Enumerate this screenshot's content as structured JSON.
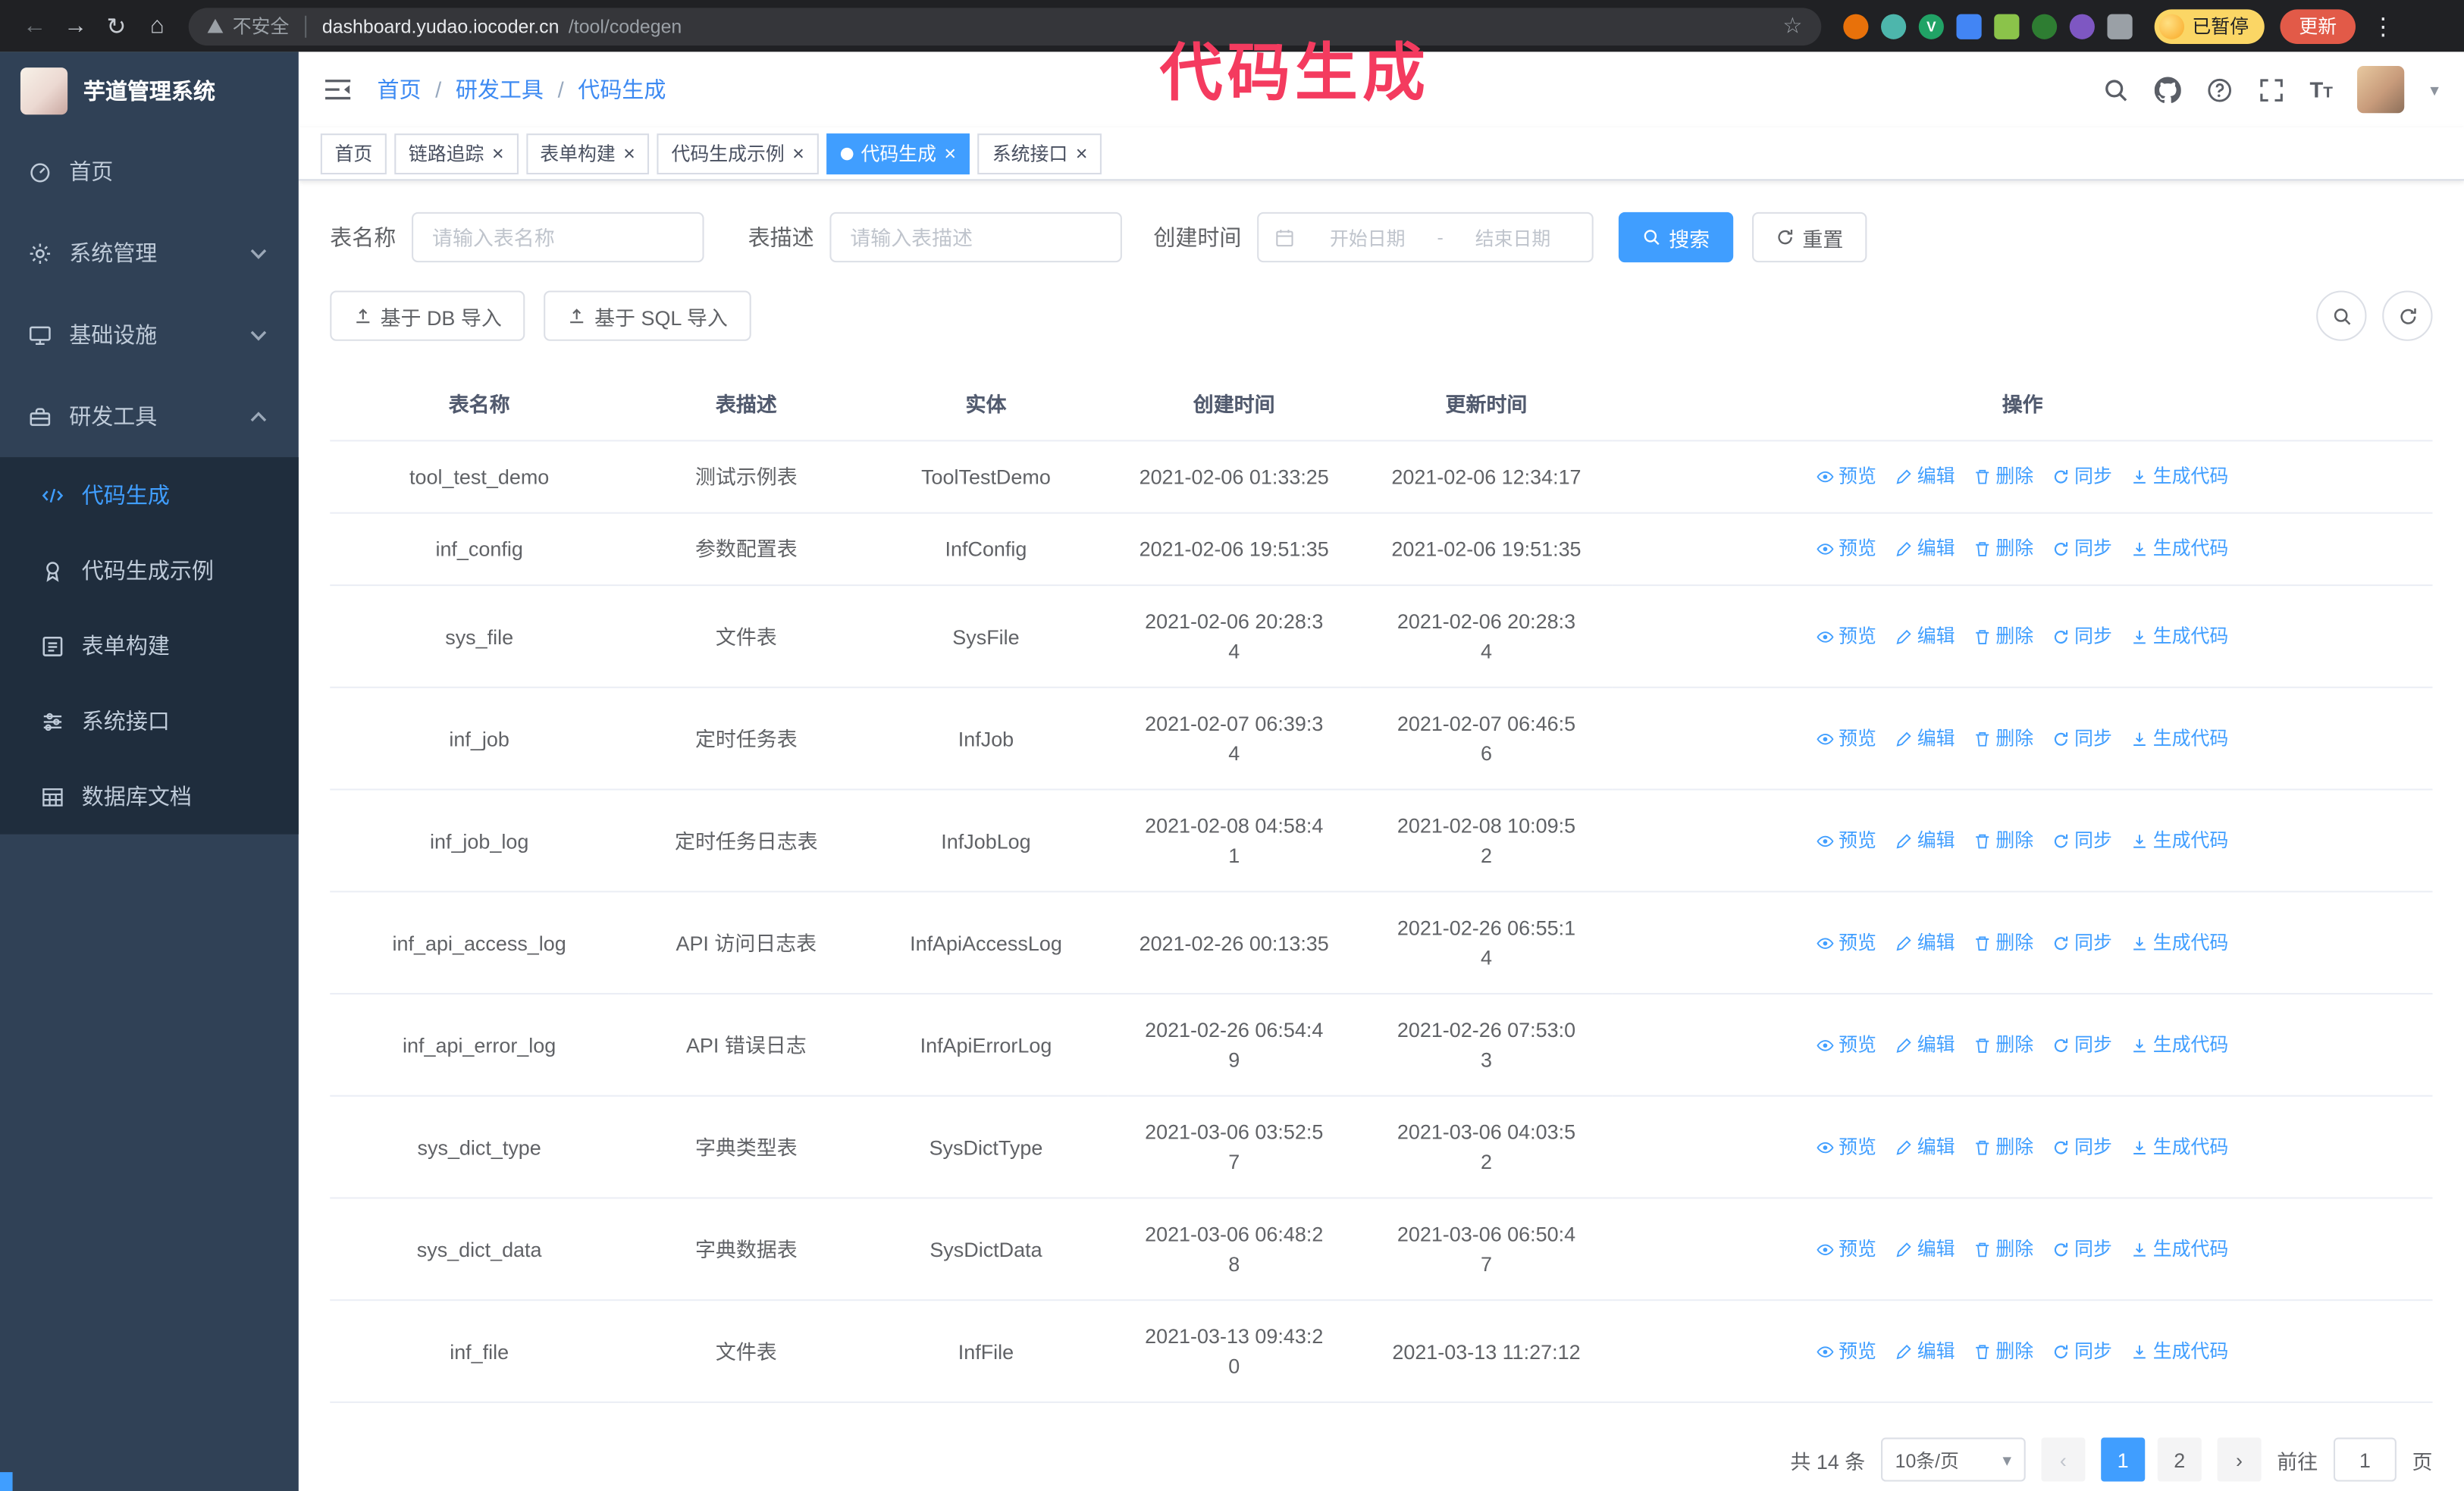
{
  "theme": {
    "primary": "#409eff",
    "sidebar_bg": "#304156",
    "submenu_bg": "#1f2d3d",
    "chrome_bg": "#202124",
    "annotation_color": "#f43b5f"
  },
  "annotation": {
    "text": "代码生成"
  },
  "browser": {
    "security_label": "不安全",
    "url_domain": "dashboard.yudao.iocoder.cn",
    "url_path": "/tool/codegen",
    "paused_badge": "已暂停",
    "update_button": "更新"
  },
  "sidebar": {
    "logo_title": "芋道管理系统",
    "items": [
      {
        "label": "首页"
      },
      {
        "label": "系统管理"
      },
      {
        "label": "基础设施"
      },
      {
        "label": "研发工具"
      }
    ],
    "submenu": [
      {
        "label": "代码生成",
        "active": true
      },
      {
        "label": "代码生成示例"
      },
      {
        "label": "表单构建"
      },
      {
        "label": "系统接口"
      },
      {
        "label": "数据库文档"
      }
    ]
  },
  "header": {
    "breadcrumb": [
      "首页",
      "研发工具",
      "代码生成"
    ]
  },
  "tabs": [
    {
      "label": "首页",
      "closable": false,
      "active": false
    },
    {
      "label": "链路追踪",
      "closable": true,
      "active": false
    },
    {
      "label": "表单构建",
      "closable": true,
      "active": false
    },
    {
      "label": "代码生成示例",
      "closable": true,
      "active": false
    },
    {
      "label": "代码生成",
      "closable": true,
      "active": true
    },
    {
      "label": "系统接口",
      "closable": true,
      "active": false
    }
  ],
  "filters": {
    "table_name_label": "表名称",
    "table_name_placeholder": "请输入表名称",
    "table_desc_label": "表描述",
    "table_desc_placeholder": "请输入表描述",
    "create_time_label": "创建时间",
    "date_start_placeholder": "开始日期",
    "date_separator": "-",
    "date_end_placeholder": "结束日期",
    "search_button": "搜索",
    "reset_button": "重置"
  },
  "toolbar": {
    "import_db_button": "基于 DB 导入",
    "import_sql_button": "基于 SQL 导入"
  },
  "table": {
    "columns": [
      "表名称",
      "表描述",
      "实体",
      "创建时间",
      "更新时间",
      "操作"
    ],
    "actions": [
      {
        "label": "预览"
      },
      {
        "label": "编辑"
      },
      {
        "label": "删除"
      },
      {
        "label": "同步"
      },
      {
        "label": "生成代码"
      }
    ],
    "rows": [
      {
        "name": "tool_test_demo",
        "desc": "测试示例表",
        "entity": "ToolTestDemo",
        "created": "2021-02-06 01:33:25",
        "updated": "2021-02-06 12:34:17"
      },
      {
        "name": "inf_config",
        "desc": "参数配置表",
        "entity": "InfConfig",
        "created": "2021-02-06 19:51:35",
        "updated": "2021-02-06 19:51:35"
      },
      {
        "name": "sys_file",
        "desc": "文件表",
        "entity": "SysFile",
        "created": "2021-02-06 20:28:3\n4",
        "updated": "2021-02-06 20:28:3\n4"
      },
      {
        "name": "inf_job",
        "desc": "定时任务表",
        "entity": "InfJob",
        "created": "2021-02-07 06:39:3\n4",
        "updated": "2021-02-07 06:46:5\n6"
      },
      {
        "name": "inf_job_log",
        "desc": "定时任务日志表",
        "entity": "InfJobLog",
        "created": "2021-02-08 04:58:4\n1",
        "updated": "2021-02-08 10:09:5\n2"
      },
      {
        "name": "inf_api_access_log",
        "desc": "API 访问日志表",
        "entity": "InfApiAccessLog",
        "created": "2021-02-26 00:13:35",
        "updated": "2021-02-26 06:55:1\n4"
      },
      {
        "name": "inf_api_error_log",
        "desc": "API 错误日志",
        "entity": "InfApiErrorLog",
        "created": "2021-02-26 06:54:4\n9",
        "updated": "2021-02-26 07:53:0\n3"
      },
      {
        "name": "sys_dict_type",
        "desc": "字典类型表",
        "entity": "SysDictType",
        "created": "2021-03-06 03:52:5\n7",
        "updated": "2021-03-06 04:03:5\n2"
      },
      {
        "name": "sys_dict_data",
        "desc": "字典数据表",
        "entity": "SysDictData",
        "created": "2021-03-06 06:48:2\n8",
        "updated": "2021-03-06 06:50:4\n7"
      },
      {
        "name": "inf_file",
        "desc": "文件表",
        "entity": "InfFile",
        "created": "2021-03-13 09:43:2\n0",
        "updated": "2021-03-13 11:27:12"
      }
    ]
  },
  "pagination": {
    "total": "共 14 条",
    "page_size": "10条/页",
    "pages": [
      {
        "label": "1",
        "active": true
      },
      {
        "label": "2",
        "active": false
      }
    ],
    "goto_label": "前往",
    "goto_value": "1",
    "goto_suffix": "页"
  }
}
